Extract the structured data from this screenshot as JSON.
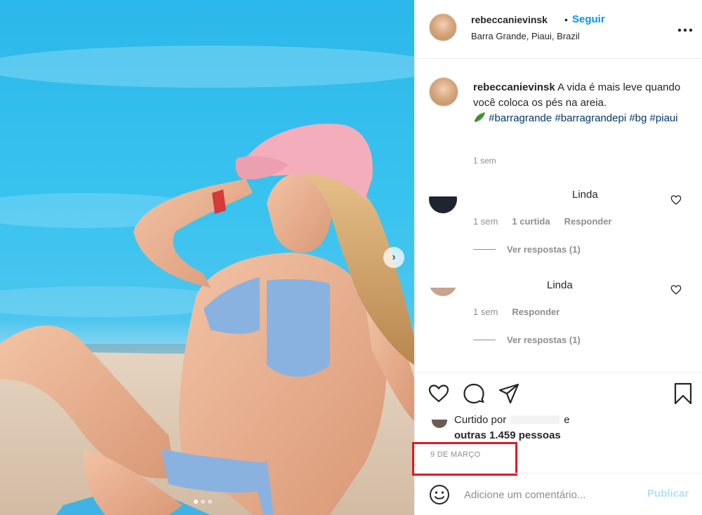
{
  "post": {
    "username": "rebeccanievinsk",
    "separator": "•",
    "follow_label": "Seguir",
    "location": "Barra Grande, Piaui, Brazil",
    "more_label": "•••"
  },
  "caption": {
    "username": "rebeccanievinsk",
    "text": "A vida é mais leve quando você coloca os pés na areia.",
    "hashtags": [
      "#barragrande",
      "#barragrandepi",
      "#bg",
      "#piaui"
    ],
    "time": "1 sem"
  },
  "comments": [
    {
      "name": "Linda",
      "time": "1 sem",
      "likes": "1 curtida",
      "reply_label": "Responder",
      "view_replies": "Ver respostas (1)"
    },
    {
      "name": "Linda",
      "time": "1 sem",
      "reply_label": "Responder",
      "view_replies": "Ver respostas (1)"
    }
  ],
  "likes": {
    "prefix": "Curtido por",
    "joiner": "e",
    "count_text": "outras 1.459 pessoas"
  },
  "date": "9 DE MARÇO",
  "comment_box": {
    "placeholder": "Adicione um comentário...",
    "publish_label": "Publicar"
  },
  "icons": {
    "like": "heart-icon",
    "comment": "comment-icon",
    "share": "paper-plane-icon",
    "save": "bookmark-icon",
    "emoji": "smiley-icon",
    "next": "chevron-right-icon"
  },
  "colors": {
    "accent": "#0095f6",
    "hashtag": "#00376b",
    "muted": "#8e8e8e",
    "highlight": "#e01b24",
    "publish_disabled": "#b2dffc"
  },
  "carousel": {
    "count": 3,
    "active": 1
  }
}
